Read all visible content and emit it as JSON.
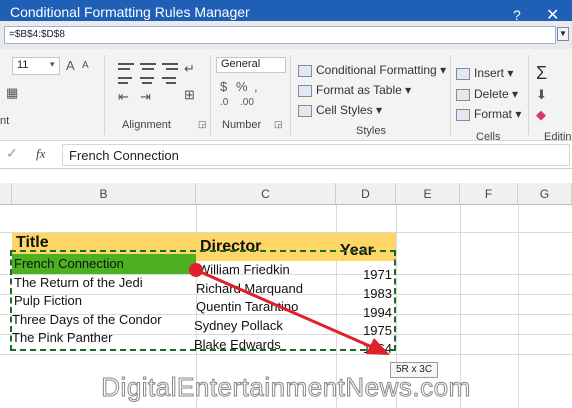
{
  "dialog": {
    "title": "Conditional Formatting Rules Manager",
    "help": "?",
    "close": "✕",
    "range_value": "=$B$4:$D$8"
  },
  "ribbon": {
    "font_size": "11",
    "number_format": "General",
    "conditional_formatting": "Conditional Formatting",
    "format_as_table": "Format as Table",
    "cell_styles": "Cell Styles",
    "insert": "Insert",
    "delete": "Delete",
    "format": "Format",
    "groups": {
      "font_partial": "nt",
      "alignment": "Alignment",
      "number": "Number",
      "styles": "Styles",
      "cells": "Cells",
      "editing_partial": "Editin"
    }
  },
  "formula_bar": {
    "fx": "fx",
    "value": "French Connection"
  },
  "columns": [
    "B",
    "C",
    "D",
    "E",
    "F",
    "G"
  ],
  "table": {
    "headers": {
      "title": "Title",
      "director": "Director",
      "year": "Year"
    },
    "rows": [
      {
        "title": "French Connection",
        "director": "William Friedkin",
        "year": "1971"
      },
      {
        "title": "The Return of the Jedi",
        "director": "Richard Marquand",
        "year": "1983"
      },
      {
        "title": "Pulp Fiction",
        "director": "Quentin Tarantino",
        "year": "1994"
      },
      {
        "title": "Three Days of the Condor",
        "director": "Sydney Pollack",
        "year": "1975"
      },
      {
        "title": "The Pink Panther",
        "director": "Blake Edwards",
        "year": "1964"
      }
    ]
  },
  "selection_size": "5R x 3C",
  "watermark": "DigitalEntertainmentNews.com",
  "colors": {
    "title_bar": "#1f5fb5",
    "header_fill": "#fdd666",
    "active_cell": "#4cb020",
    "arrow": "#e0202a"
  }
}
